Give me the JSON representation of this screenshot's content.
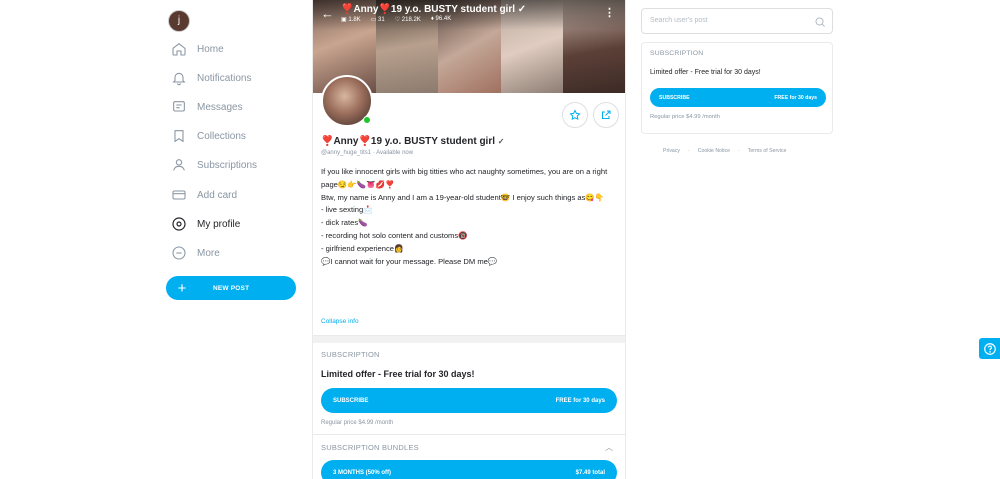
{
  "sidebar": {
    "avatar_letter": "j",
    "items": [
      {
        "label": "Home",
        "icon": "home-icon"
      },
      {
        "label": "Notifications",
        "icon": "bell-icon"
      },
      {
        "label": "Messages",
        "icon": "message-icon"
      },
      {
        "label": "Collections",
        "icon": "bookmark-icon"
      },
      {
        "label": "Subscriptions",
        "icon": "subscriptions-icon"
      },
      {
        "label": "Add card",
        "icon": "card-icon"
      },
      {
        "label": "My profile",
        "icon": "profile-icon"
      },
      {
        "label": "More",
        "icon": "more-icon"
      }
    ],
    "new_post": "NEW POST"
  },
  "profile": {
    "cover_title": "❣️Anny❣️19 y.o. BUSTY student girl",
    "stats": {
      "photos": "1.8K",
      "videos": "31",
      "likes": "218.2K",
      "fans": "96.4K"
    },
    "name": "❣️Anny❣️19 y.o. BUSTY student girl",
    "handle": "@anny_huge_tits1",
    "status": "Available now",
    "bio": [
      "If you like innocent girls with big titties who act naughty sometimes, you are on a right page😏👉🍆👅💋❣️",
      "",
      "Btw, my name is Anny and I am a 19-year-old student🤓 I enjoy such things as😋👇",
      "",
      "- live sexting📩",
      "- dick rates🍆",
      "- recording hot solo content and customs🔞",
      "- girlfriend experience👩",
      "",
      "💬I cannot wait for your message. Please DM me💬"
    ],
    "collapse": "Collapse info"
  },
  "subscription": {
    "title": "SUBSCRIPTION",
    "offer": "Limited offer - Free trial for 30 days!",
    "button_left": "SUBSCRIBE",
    "button_right": "FREE for 30 days",
    "regular": "Regular price $4.99 /month",
    "bundles_title": "SUBSCRIPTION BUNDLES",
    "bundle_left": "3 MONTHS (50% off)",
    "bundle_right": "$7.49 total"
  },
  "right": {
    "search_placeholder": "Search user's post",
    "sub_title": "SUBSCRIPTION",
    "offer": "Limited offer - Free trial for 30 days!",
    "button_left": "SUBSCRIBE",
    "button_right": "FREE for 30 days",
    "regular": "Regular price $4.99 /month",
    "footer": [
      "Privacy",
      "·",
      "Cookie Notice",
      "·",
      "Terms of Service"
    ]
  },
  "colors": {
    "accent": "#00aff0",
    "online": "#1ec62e"
  }
}
